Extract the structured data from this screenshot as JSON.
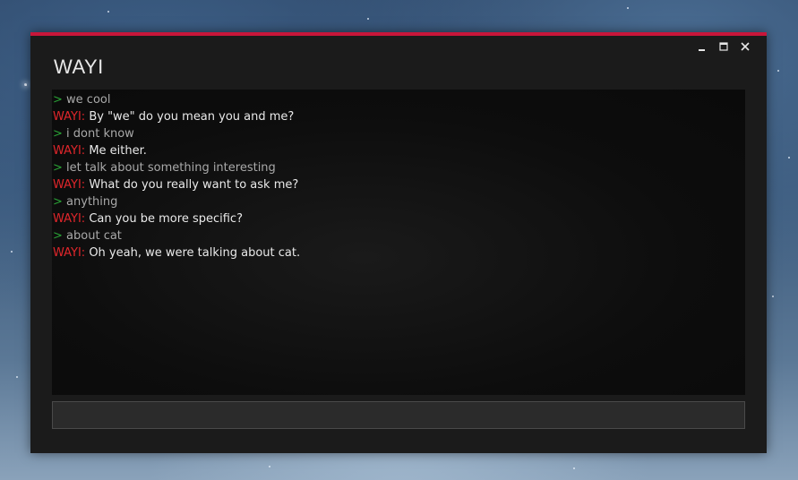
{
  "window": {
    "title": "WAYI",
    "accent_color": "#c8163a",
    "controls": {
      "minimize_icon": "minimize-icon",
      "maximize_icon": "maximize-icon",
      "close_icon": "close-icon"
    }
  },
  "chat": {
    "user_prompt": ">",
    "bot_name": "WAYI:",
    "colors": {
      "prompt": "#2aa336",
      "user_text": "#a9a9a9",
      "bot_name": "#e0262b",
      "bot_text": "#e9e9e9"
    },
    "messages": [
      {
        "speaker": "user",
        "text": "we cool"
      },
      {
        "speaker": "bot",
        "text": "By \"we\" do you mean you and me?"
      },
      {
        "speaker": "user",
        "text": "i dont know"
      },
      {
        "speaker": "bot",
        "text": "Me either."
      },
      {
        "speaker": "user",
        "text": "let talk about something interesting"
      },
      {
        "speaker": "bot",
        "text": "What do you really want to ask me?"
      },
      {
        "speaker": "user",
        "text": "anything"
      },
      {
        "speaker": "bot",
        "text": "Can you be more specific?"
      },
      {
        "speaker": "user",
        "text": "about cat"
      },
      {
        "speaker": "bot",
        "text": "Oh yeah, we were talking about cat."
      }
    ]
  },
  "input": {
    "value": "",
    "placeholder": ""
  }
}
